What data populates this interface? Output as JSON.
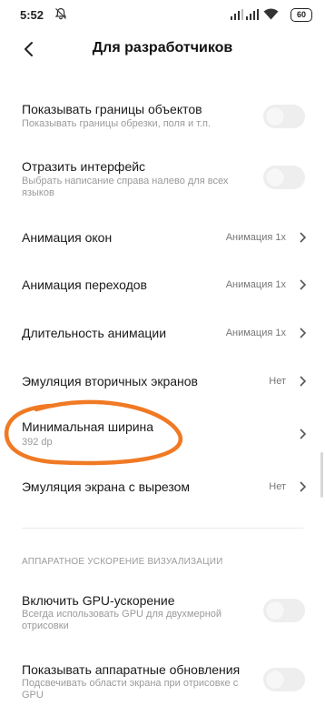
{
  "status": {
    "time": "5:52",
    "battery": "60"
  },
  "header": {
    "title": "Для разработчиков"
  },
  "settings": [
    {
      "title": "Показывать границы объектов",
      "subtitle": "Показывать границы обрезки, поля и т.п.",
      "type": "toggle",
      "on": false
    },
    {
      "title": "Отразить интерфейс",
      "subtitle": "Выбрать написание справа налево для всех языков",
      "type": "toggle",
      "on": false
    },
    {
      "title": "Анимация окон",
      "value": "Анимация 1x",
      "type": "select"
    },
    {
      "title": "Анимация переходов",
      "value": "Анимация 1x",
      "type": "select"
    },
    {
      "title": "Длительность анимации",
      "value": "Анимация 1x",
      "type": "select"
    },
    {
      "title": "Эмуляция вторичных экранов",
      "value": "Нет",
      "type": "select"
    },
    {
      "title": "Минимальная ширина",
      "subtitle": "392 dp",
      "type": "select",
      "highlighted": true
    },
    {
      "title": "Эмуляция экрана с вырезом",
      "value": "Нет",
      "type": "select"
    }
  ],
  "section_hw": {
    "header": "АППАРАТНОЕ УСКОРЕНИЕ ВИЗУАЛИЗАЦИИ",
    "items": [
      {
        "title": "Включить GPU-ускорение",
        "subtitle": "Всегда использовать GPU для двухмерной отрисовки",
        "type": "toggle",
        "on": false
      },
      {
        "title": "Показывать аппаратные обновления",
        "subtitle": "Подсвечивать области экрана при отрисовке с GPU",
        "type": "toggle",
        "on": false
      }
    ]
  },
  "colors": {
    "annotation": "#f07a24",
    "toggle_off": "#eeeeee"
  }
}
